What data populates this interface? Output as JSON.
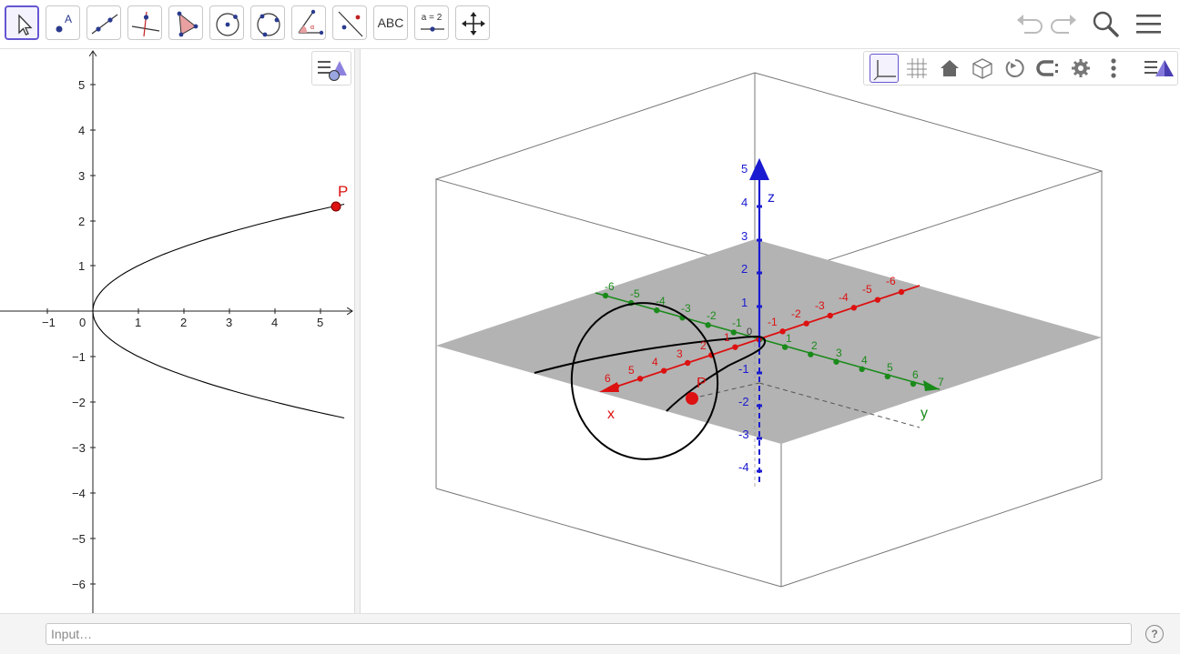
{
  "toolbar": {
    "tools": [
      {
        "icon": "move-arrow-icon",
        "label": "Move"
      },
      {
        "icon": "point-icon",
        "label": "Point",
        "badge": "A"
      },
      {
        "icon": "line-icon",
        "label": "Line"
      },
      {
        "icon": "perpendicular-line-icon",
        "label": "Perpendicular Line"
      },
      {
        "icon": "polygon-icon",
        "label": "Polygon"
      },
      {
        "icon": "circle-icon",
        "label": "Circle with Center through Point"
      },
      {
        "icon": "circle-through-3-points-icon",
        "label": "Circle through 3 Points"
      },
      {
        "icon": "angle-icon",
        "label": "Angle"
      },
      {
        "icon": "reflect-about-line-icon",
        "label": "Reflect about Line"
      },
      {
        "icon": "text-icon",
        "label": "Text",
        "text": "ABC"
      },
      {
        "icon": "slider-icon",
        "label": "Slider",
        "text": "a = 2"
      },
      {
        "icon": "move-graphics-view-icon",
        "label": "Move Graphics View"
      }
    ],
    "right": [
      "undo-icon",
      "redo-icon",
      "search-icon",
      "menu-icon"
    ]
  },
  "graphics_view": {
    "x_ticks": [
      "−1",
      "0",
      "1",
      "2",
      "3",
      "4",
      "5"
    ],
    "y_ticks": [
      "5",
      "4",
      "3",
      "2",
      "1",
      "−1",
      "−2",
      "−3",
      "−4",
      "−5",
      "−6"
    ],
    "point_label": "P",
    "point_color": "#dd1111",
    "curve_color": "#000000"
  },
  "view3d": {
    "stylebar": [
      "axes-icon",
      "grid-icon",
      "home-icon",
      "box-icon",
      "rotate-view-icon",
      "projection-icon",
      "settings-icon",
      "more-options-icon",
      "toggle-style-bar-icon"
    ],
    "z_label": "z",
    "x_label": "x",
    "y_label": "y",
    "p_label": "P",
    "z_ticks": [
      "5",
      "4",
      "3",
      "2",
      "1",
      "-1",
      "-2",
      "-3",
      "-4"
    ],
    "x_pos_ticks": [
      "6",
      "5",
      "4",
      "3",
      "2",
      "1"
    ],
    "x_neg_ticks": [
      "-1",
      "-2",
      "-3",
      "-4",
      "-5",
      "-6"
    ],
    "y_neg_ticks": [
      "-6",
      "-5",
      "-4",
      "-3",
      "-2",
      "-1"
    ],
    "y_pos_ticks": [
      "1",
      "2",
      "3",
      "4",
      "5",
      "6",
      "7"
    ],
    "origin_label": "0",
    "colors": {
      "x_axis": "#dd1111",
      "y_axis": "#1a8a1a",
      "z_axis": "#1a1ad0",
      "plane": "#b3b3b3"
    }
  },
  "input_bar": {
    "placeholder": "Input…",
    "help": "?"
  }
}
